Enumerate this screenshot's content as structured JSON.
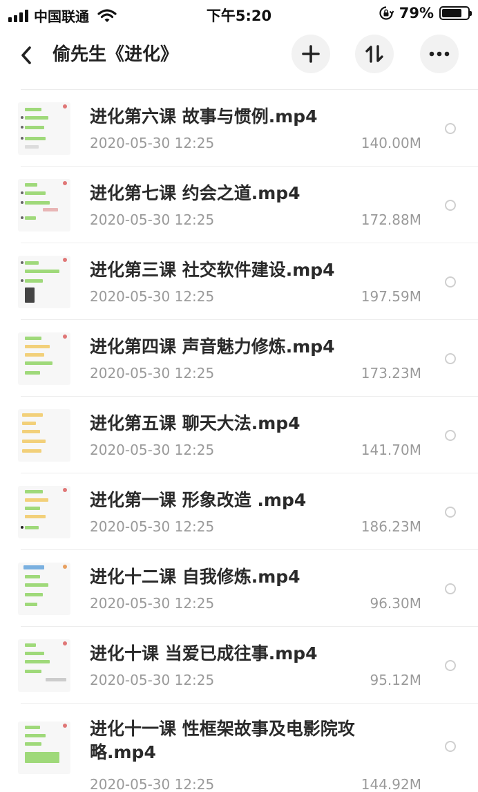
{
  "status_bar": {
    "carrier": "中国联通",
    "time": "下午5:20",
    "battery_percent": "79%",
    "battery_level": 0.79,
    "icons": [
      "signal-icon",
      "wifi-icon",
      "rotation-lock-icon",
      "battery-icon"
    ]
  },
  "header": {
    "title": "偷先生《进化》",
    "back_icon": "chevron-left-icon",
    "actions": [
      "plus-icon",
      "sort-icon",
      "more-icon"
    ]
  },
  "files": [
    {
      "name": "进化第六课 故事与惯例.mp4",
      "date": "2020-05-30 12:25",
      "size": "140.00M"
    },
    {
      "name": "进化第七课 约会之道.mp4",
      "date": "2020-05-30 12:25",
      "size": "172.88M"
    },
    {
      "name": "进化第三课 社交软件建设.mp4",
      "date": "2020-05-30 12:25",
      "size": "197.59M"
    },
    {
      "name": "进化第四课 声音魅力修炼.mp4",
      "date": "2020-05-30 12:25",
      "size": "173.23M"
    },
    {
      "name": "进化第五课 聊天大法.mp4",
      "date": "2020-05-30 12:25",
      "size": "141.70M"
    },
    {
      "name": "进化第一课 形象改造 .mp4",
      "date": "2020-05-30 12:25",
      "size": "186.23M"
    },
    {
      "name": "进化十二课 自我修炼.mp4",
      "date": "2020-05-30 12:25",
      "size": "96.30M"
    },
    {
      "name": "进化十课 当爱已成往事.mp4",
      "date": "2020-05-30 12:25",
      "size": "95.12M"
    },
    {
      "name": "进化十一课 性框架故事及电影院攻略.mp4",
      "date": "2020-05-30 12:25",
      "size": "144.92M"
    }
  ]
}
